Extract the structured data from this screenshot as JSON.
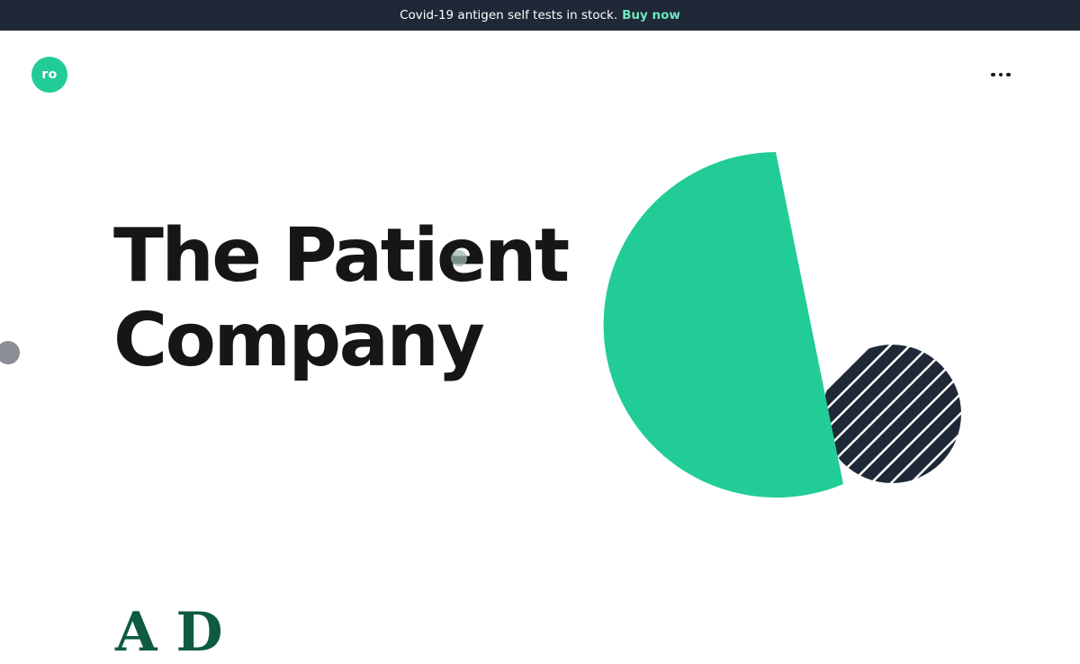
{
  "announcement": {
    "text": "Covid-19 antigen self tests in stock.",
    "link_label": "Buy now"
  },
  "header": {
    "logo_text": "ro",
    "menu_icon": "more-horizontal-icon"
  },
  "hero": {
    "title_line1": "The Patient",
    "title_line2": "Company"
  },
  "next_section": {
    "heading_partial": "A D"
  },
  "colors": {
    "brand_green": "#22cc96",
    "navy": "#1f2836",
    "announcement_link": "#6ee7c0",
    "text_dark": "#161616"
  }
}
